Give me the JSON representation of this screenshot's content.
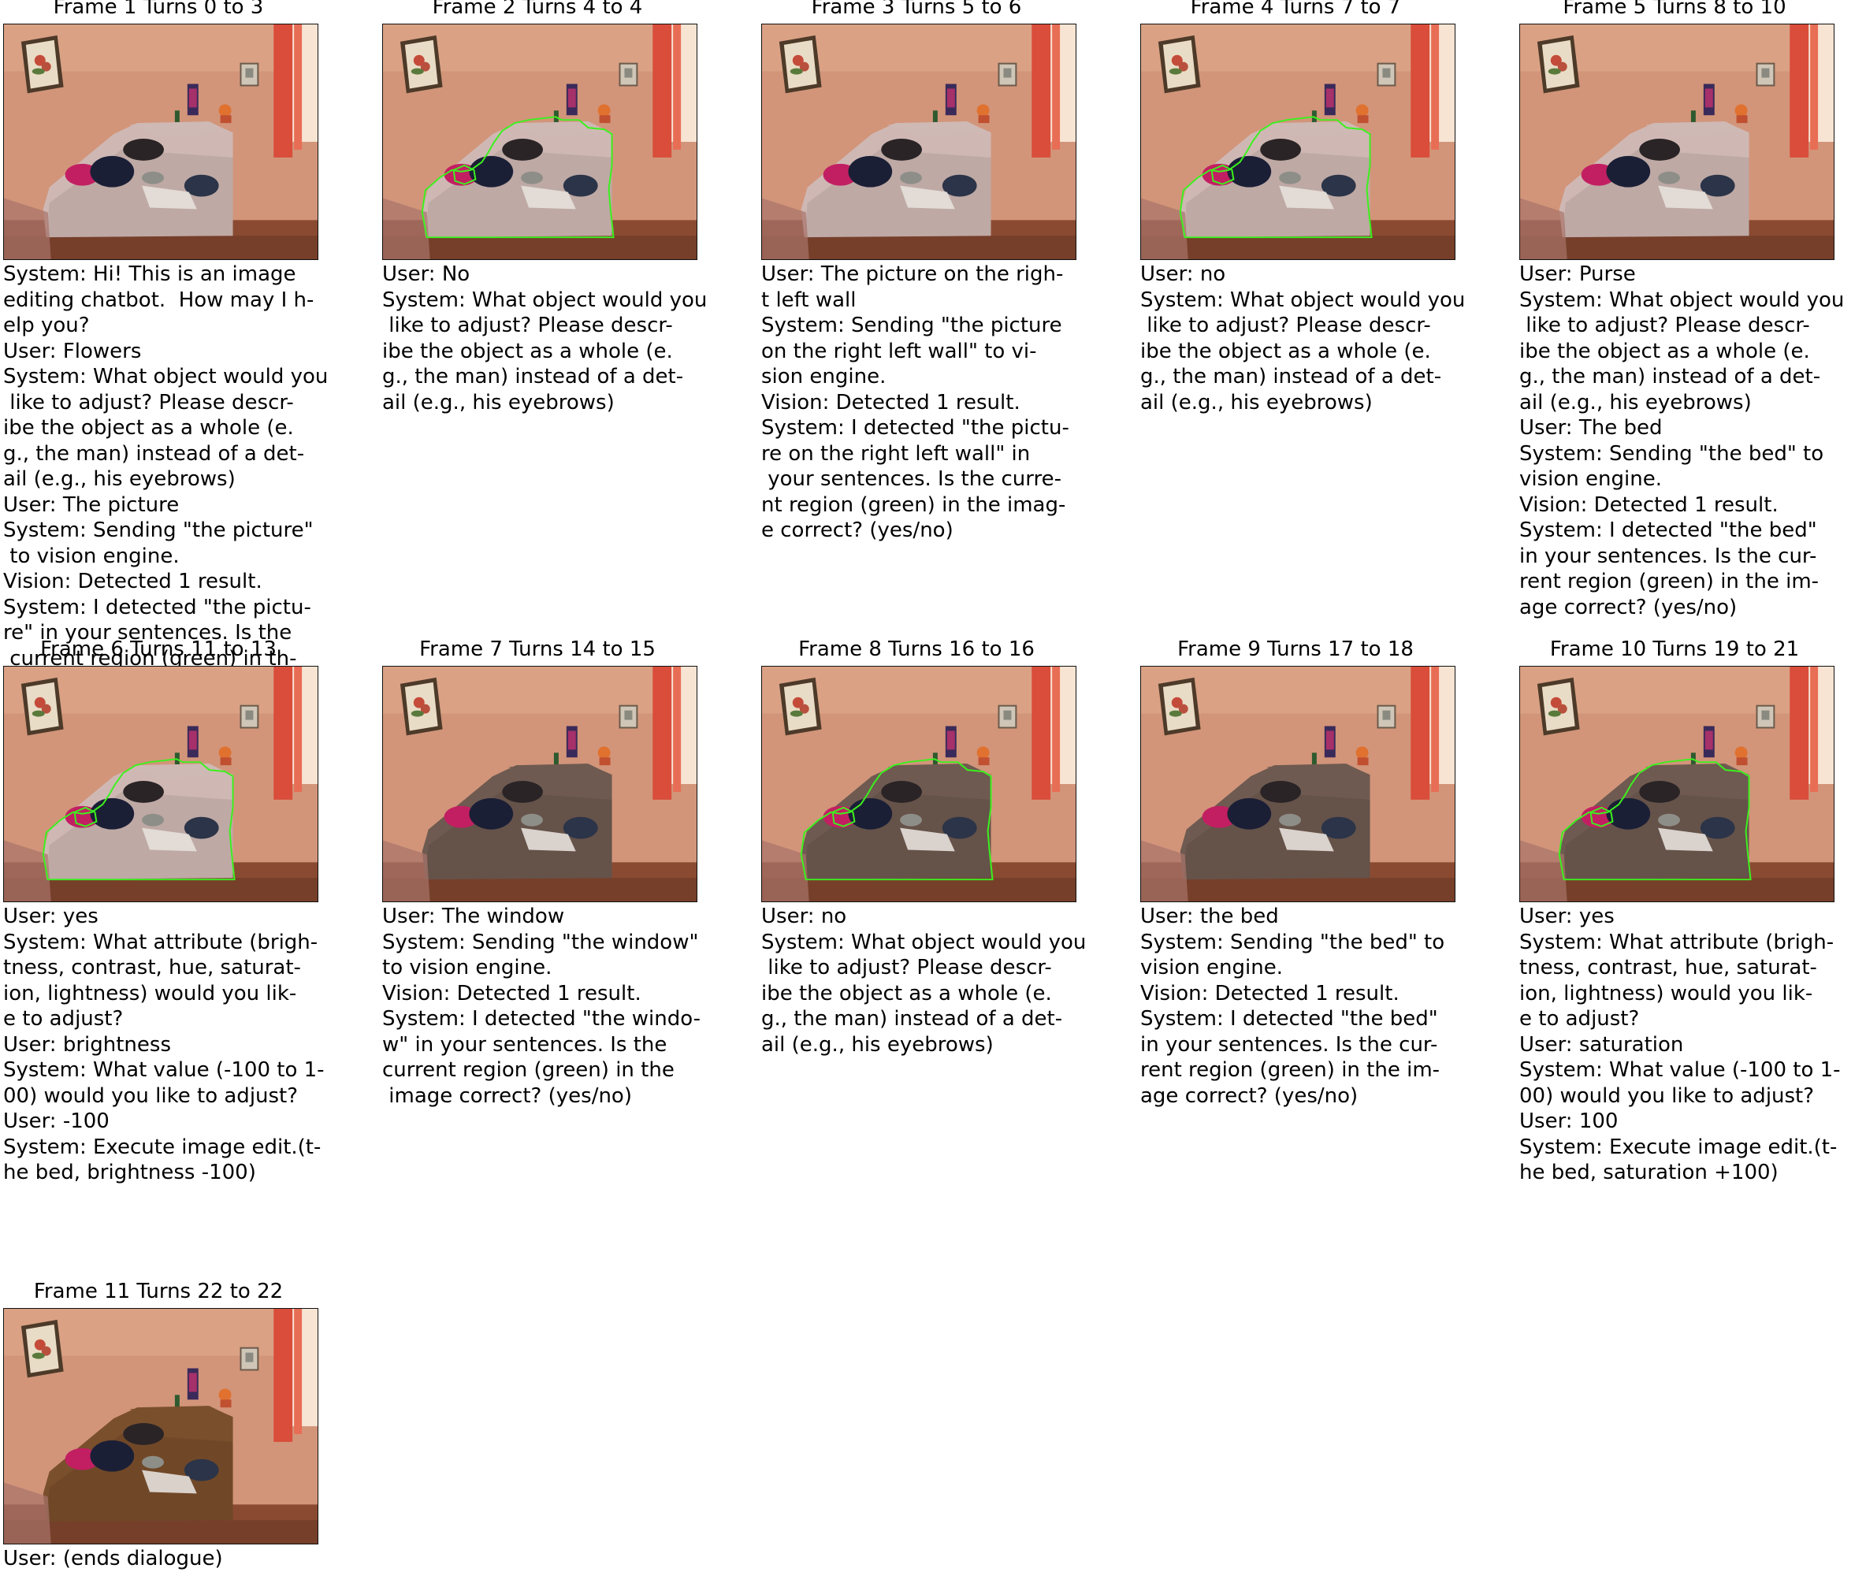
{
  "frames": [
    {
      "title": "Frame 1 Turns 0 to 3",
      "image": {
        "adjustment": "original",
        "region_outline": false
      },
      "transcript": [
        "System: Hi! This is an image",
        "editing chatbot.  How may I h-",
        "elp you?",
        "User: Flowers",
        "System: What object would you",
        " like to adjust? Please descr-",
        "ibe the object as a whole (e.",
        "g., the man) instead of a det-",
        "ail (e.g., his eyebrows)",
        "User: The picture",
        "System: Sending \"the picture\"",
        " to vision engine.",
        "Vision: Detected 1 result.",
        "System: I detected \"the pictu-",
        "re\" in your sentences. Is the",
        " current region (green) in th-"
      ]
    },
    {
      "title": "Frame 2 Turns 4 to 4",
      "image": {
        "adjustment": "original",
        "region_outline": true
      },
      "transcript": [
        "User: No",
        "System: What object would you",
        " like to adjust? Please descr-",
        "ibe the object as a whole (e.",
        "g., the man) instead of a det-",
        "ail (e.g., his eyebrows)"
      ]
    },
    {
      "title": "Frame 3 Turns 5 to 6",
      "image": {
        "adjustment": "original",
        "region_outline": false
      },
      "transcript": [
        "User: The picture on the righ-",
        "t left wall",
        "System: Sending \"the picture",
        "on the right left wall\" to vi-",
        "sion engine.",
        "Vision: Detected 1 result.",
        "System: I detected \"the pictu-",
        "re on the right left wall\" in",
        " your sentences. Is the curre-",
        "nt region (green) in the imag-",
        "e correct? (yes/no)"
      ]
    },
    {
      "title": "Frame 4 Turns 7 to 7",
      "image": {
        "adjustment": "original",
        "region_outline": true
      },
      "transcript": [
        "User: no",
        "System: What object would you",
        " like to adjust? Please descr-",
        "ibe the object as a whole (e.",
        "g., the man) instead of a det-",
        "ail (e.g., his eyebrows)"
      ]
    },
    {
      "title": "Frame 5 Turns 8 to 10",
      "image": {
        "adjustment": "original",
        "region_outline": false
      },
      "transcript": [
        "User: Purse",
        "System: What object would you",
        " like to adjust? Please descr-",
        "ibe the object as a whole (e.",
        "g., the man) instead of a det-",
        "ail (e.g., his eyebrows)",
        "User: The bed",
        "System: Sending \"the bed\" to",
        "vision engine.",
        "Vision: Detected 1 result.",
        "System: I detected \"the bed\"",
        "in your sentences. Is the cur-",
        "rent region (green) in the im-",
        "age correct? (yes/no)"
      ]
    },
    {
      "title": "Frame 6 Turns 11 to 13",
      "image": {
        "adjustment": "original",
        "region_outline": true
      },
      "transcript": [
        "User: yes",
        "System: What attribute (brigh-",
        "tness, contrast, hue, saturat-",
        "ion, lightness) would you lik-",
        "e to adjust?",
        "User: brightness",
        "System: What value (-100 to 1-",
        "00) would you like to adjust?",
        "User: -100",
        "System: Execute image edit.(t-",
        "he bed, brightness -100)"
      ]
    },
    {
      "title": "Frame 7 Turns 14 to 15",
      "image": {
        "adjustment": "dark-bed",
        "region_outline": false
      },
      "transcript": [
        "User: The window",
        "System: Sending \"the window\"",
        "to vision engine.",
        "Vision: Detected 1 result.",
        "System: I detected \"the windo-",
        "w\" in your sentences. Is the",
        "current region (green) in the",
        " image correct? (yes/no)"
      ]
    },
    {
      "title": "Frame 8 Turns 16 to 16",
      "image": {
        "adjustment": "dark-bed",
        "region_outline": true
      },
      "transcript": [
        "User: no",
        "System: What object would you",
        " like to adjust? Please descr-",
        "ibe the object as a whole (e.",
        "g., the man) instead of a det-",
        "ail (e.g., his eyebrows)"
      ]
    },
    {
      "title": "Frame 9 Turns 17 to 18",
      "image": {
        "adjustment": "dark-bed",
        "region_outline": false
      },
      "transcript": [
        "User: the bed",
        "System: Sending \"the bed\" to",
        "vision engine.",
        "Vision: Detected 1 result.",
        "System: I detected \"the bed\"",
        "in your sentences. Is the cur-",
        "rent region (green) in the im-",
        "age correct? (yes/no)"
      ]
    },
    {
      "title": "Frame 10 Turns 19 to 21",
      "image": {
        "adjustment": "dark-bed",
        "region_outline": true
      },
      "transcript": [
        "User: yes",
        "System: What attribute (brigh-",
        "tness, contrast, hue, saturat-",
        "ion, lightness) would you lik-",
        "e to adjust?",
        "User: saturation",
        "System: What value (-100 to 1-",
        "00) would you like to adjust?",
        "User: 100",
        "System: Execute image edit.(t-",
        "he bed, saturation +100)"
      ]
    },
    {
      "title": "Frame 11 Turns 22 to 22",
      "image": {
        "adjustment": "saturated-bed",
        "region_outline": false
      },
      "transcript": [
        "User: (ends dialogue)"
      ]
    }
  ],
  "colors": {
    "region_outline": "#3cf01e",
    "wall": "#d2957a",
    "bed_original": "#cfb8b4",
    "bed_dark": "#6e5a50",
    "bed_saturated": "#7a4f2c"
  }
}
